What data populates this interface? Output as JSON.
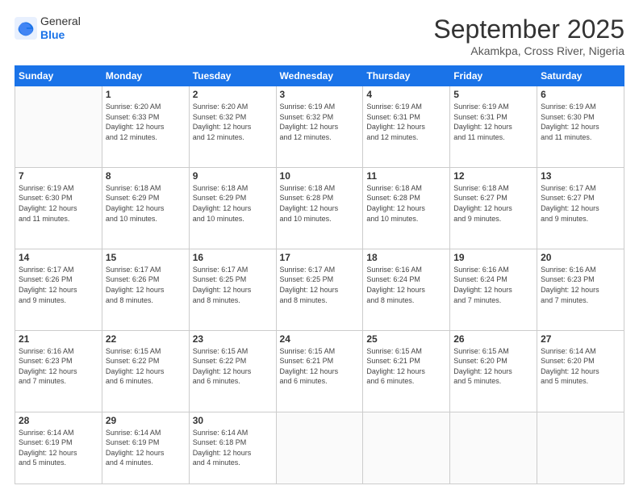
{
  "header": {
    "logo": {
      "line1": "General",
      "line2": "Blue"
    },
    "title": "September 2025",
    "subtitle": "Akamkpa, Cross River, Nigeria"
  },
  "calendar": {
    "days_of_week": [
      "Sunday",
      "Monday",
      "Tuesday",
      "Wednesday",
      "Thursday",
      "Friday",
      "Saturday"
    ],
    "weeks": [
      [
        {
          "day": "",
          "info": ""
        },
        {
          "day": "1",
          "info": "Sunrise: 6:20 AM\nSunset: 6:33 PM\nDaylight: 12 hours\nand 12 minutes."
        },
        {
          "day": "2",
          "info": "Sunrise: 6:20 AM\nSunset: 6:32 PM\nDaylight: 12 hours\nand 12 minutes."
        },
        {
          "day": "3",
          "info": "Sunrise: 6:19 AM\nSunset: 6:32 PM\nDaylight: 12 hours\nand 12 minutes."
        },
        {
          "day": "4",
          "info": "Sunrise: 6:19 AM\nSunset: 6:31 PM\nDaylight: 12 hours\nand 12 minutes."
        },
        {
          "day": "5",
          "info": "Sunrise: 6:19 AM\nSunset: 6:31 PM\nDaylight: 12 hours\nand 11 minutes."
        },
        {
          "day": "6",
          "info": "Sunrise: 6:19 AM\nSunset: 6:30 PM\nDaylight: 12 hours\nand 11 minutes."
        }
      ],
      [
        {
          "day": "7",
          "info": "Sunrise: 6:19 AM\nSunset: 6:30 PM\nDaylight: 12 hours\nand 11 minutes."
        },
        {
          "day": "8",
          "info": "Sunrise: 6:18 AM\nSunset: 6:29 PM\nDaylight: 12 hours\nand 10 minutes."
        },
        {
          "day": "9",
          "info": "Sunrise: 6:18 AM\nSunset: 6:29 PM\nDaylight: 12 hours\nand 10 minutes."
        },
        {
          "day": "10",
          "info": "Sunrise: 6:18 AM\nSunset: 6:28 PM\nDaylight: 12 hours\nand 10 minutes."
        },
        {
          "day": "11",
          "info": "Sunrise: 6:18 AM\nSunset: 6:28 PM\nDaylight: 12 hours\nand 10 minutes."
        },
        {
          "day": "12",
          "info": "Sunrise: 6:18 AM\nSunset: 6:27 PM\nDaylight: 12 hours\nand 9 minutes."
        },
        {
          "day": "13",
          "info": "Sunrise: 6:17 AM\nSunset: 6:27 PM\nDaylight: 12 hours\nand 9 minutes."
        }
      ],
      [
        {
          "day": "14",
          "info": "Sunrise: 6:17 AM\nSunset: 6:26 PM\nDaylight: 12 hours\nand 9 minutes."
        },
        {
          "day": "15",
          "info": "Sunrise: 6:17 AM\nSunset: 6:26 PM\nDaylight: 12 hours\nand 8 minutes."
        },
        {
          "day": "16",
          "info": "Sunrise: 6:17 AM\nSunset: 6:25 PM\nDaylight: 12 hours\nand 8 minutes."
        },
        {
          "day": "17",
          "info": "Sunrise: 6:17 AM\nSunset: 6:25 PM\nDaylight: 12 hours\nand 8 minutes."
        },
        {
          "day": "18",
          "info": "Sunrise: 6:16 AM\nSunset: 6:24 PM\nDaylight: 12 hours\nand 8 minutes."
        },
        {
          "day": "19",
          "info": "Sunrise: 6:16 AM\nSunset: 6:24 PM\nDaylight: 12 hours\nand 7 minutes."
        },
        {
          "day": "20",
          "info": "Sunrise: 6:16 AM\nSunset: 6:23 PM\nDaylight: 12 hours\nand 7 minutes."
        }
      ],
      [
        {
          "day": "21",
          "info": "Sunrise: 6:16 AM\nSunset: 6:23 PM\nDaylight: 12 hours\nand 7 minutes."
        },
        {
          "day": "22",
          "info": "Sunrise: 6:15 AM\nSunset: 6:22 PM\nDaylight: 12 hours\nand 6 minutes."
        },
        {
          "day": "23",
          "info": "Sunrise: 6:15 AM\nSunset: 6:22 PM\nDaylight: 12 hours\nand 6 minutes."
        },
        {
          "day": "24",
          "info": "Sunrise: 6:15 AM\nSunset: 6:21 PM\nDaylight: 12 hours\nand 6 minutes."
        },
        {
          "day": "25",
          "info": "Sunrise: 6:15 AM\nSunset: 6:21 PM\nDaylight: 12 hours\nand 6 minutes."
        },
        {
          "day": "26",
          "info": "Sunrise: 6:15 AM\nSunset: 6:20 PM\nDaylight: 12 hours\nand 5 minutes."
        },
        {
          "day": "27",
          "info": "Sunrise: 6:14 AM\nSunset: 6:20 PM\nDaylight: 12 hours\nand 5 minutes."
        }
      ],
      [
        {
          "day": "28",
          "info": "Sunrise: 6:14 AM\nSunset: 6:19 PM\nDaylight: 12 hours\nand 5 minutes."
        },
        {
          "day": "29",
          "info": "Sunrise: 6:14 AM\nSunset: 6:19 PM\nDaylight: 12 hours\nand 4 minutes."
        },
        {
          "day": "30",
          "info": "Sunrise: 6:14 AM\nSunset: 6:18 PM\nDaylight: 12 hours\nand 4 minutes."
        },
        {
          "day": "",
          "info": ""
        },
        {
          "day": "",
          "info": ""
        },
        {
          "day": "",
          "info": ""
        },
        {
          "day": "",
          "info": ""
        }
      ]
    ]
  }
}
